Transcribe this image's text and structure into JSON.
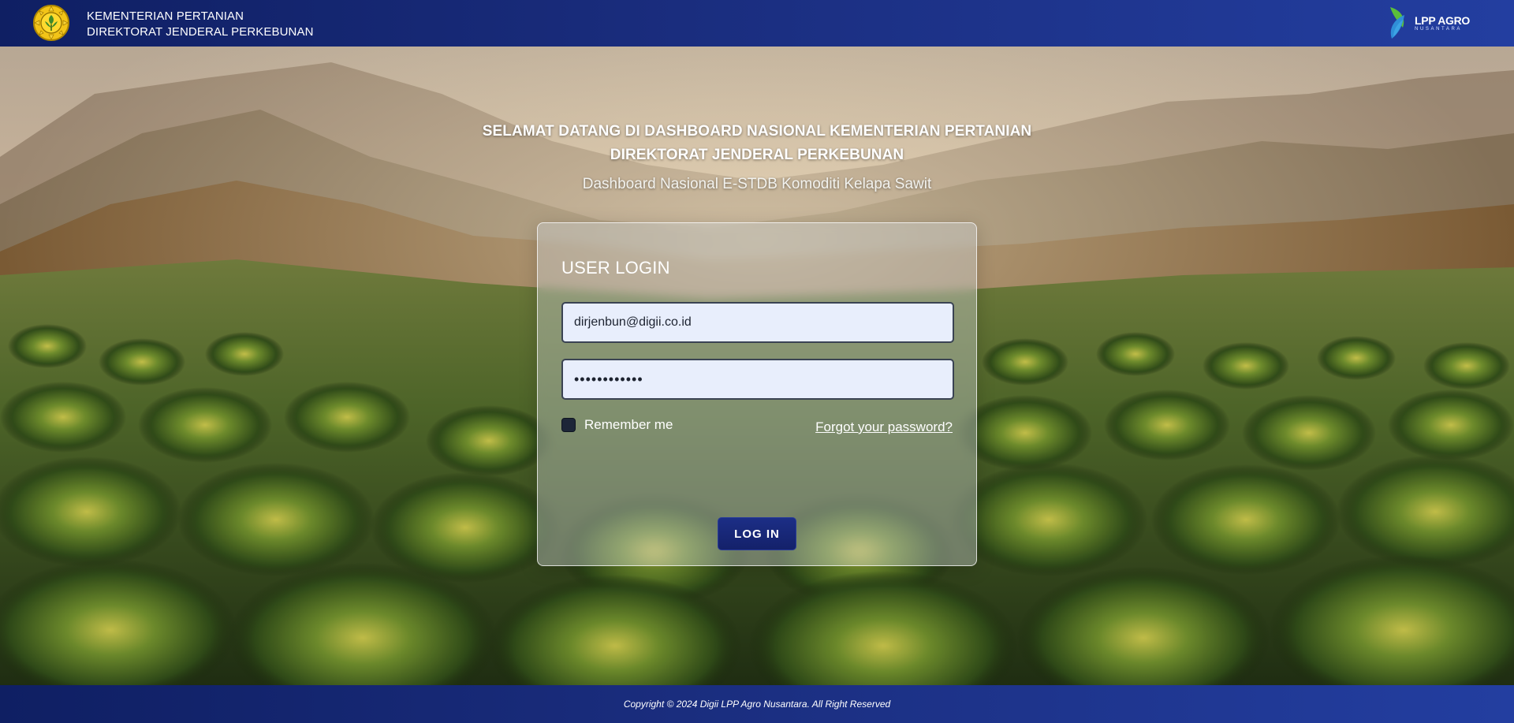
{
  "header": {
    "ministry_line1": "KEMENTERIAN PERTANIAN",
    "ministry_line2": "DIREKTORAT JENDERAL PERKEBUNAN",
    "brand_name": "LPP AGRO",
    "brand_tagline": "NUSANTARA"
  },
  "welcome": {
    "line1": "SELAMAT DATANG DI DASHBOARD NASIONAL KEMENTERIAN PERTANIAN",
    "line2": "DIREKTORAT JENDERAL PERKEBUNAN",
    "subtitle": "Dashboard Nasional E-STDB Komoditi Kelapa Sawit"
  },
  "login": {
    "title": "USER LOGIN",
    "email_value": "dirjenbun@digii.co.id",
    "password_value": "••••••••••••",
    "remember_label": "Remember me",
    "remember_checked": false,
    "forgot_label": "Forgot your password?",
    "submit_label": "LOG IN"
  },
  "footer": {
    "copyright": "Copyright © 2024 Digii LPP Agro Nusantara. All Right Reserved"
  },
  "icons": {
    "ministry_logo": "ministry-emblem-icon",
    "brand_logo": "lpp-agro-leaf-icon"
  },
  "colors": {
    "header_bg": "#1a2d7e",
    "footer_bg": "#1a2d7e",
    "button_bg": "#1c2e86",
    "input_bg": "#e8eefc",
    "brand_leaf_green": "#5bbf3a",
    "brand_leaf_blue": "#2f8fd8"
  }
}
